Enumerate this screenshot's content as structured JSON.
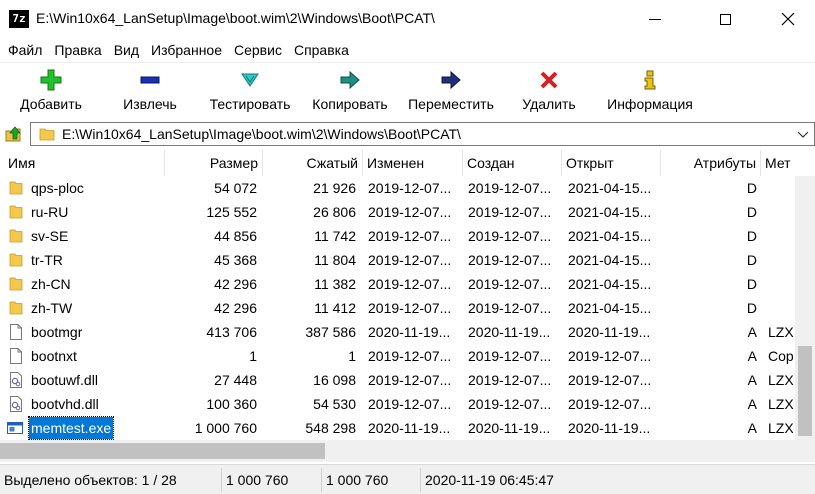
{
  "window": {
    "title": "E:\\Win10x64_LanSetup\\Image\\boot.wim\\2\\Windows\\Boot\\PCAT\\",
    "app_icon_text": "7z"
  },
  "menu": [
    "Файл",
    "Правка",
    "Вид",
    "Избранное",
    "Сервис",
    "Справка"
  ],
  "toolbar": [
    {
      "label": "Добавить",
      "icon": "add-icon",
      "color": "#22c02a"
    },
    {
      "label": "Извлечь",
      "icon": "extract-icon",
      "color": "#1a2fb8"
    },
    {
      "label": "Тестировать",
      "icon": "test-icon",
      "color": "#2fc9c9"
    },
    {
      "label": "Копировать",
      "icon": "copy-icon",
      "color": "#1f8f84"
    },
    {
      "label": "Переместить",
      "icon": "move-icon",
      "color": "#1f2f7a"
    },
    {
      "label": "Удалить",
      "icon": "delete-icon",
      "color": "#d42020"
    },
    {
      "label": "Информация",
      "icon": "info-icon",
      "color": "#e8c31a"
    }
  ],
  "address": {
    "path": "E:\\Win10x64_LanSetup\\Image\\boot.wim\\2\\Windows\\Boot\\PCAT\\"
  },
  "columns": [
    "Имя",
    "Размер",
    "Сжатый",
    "Изменен",
    "Создан",
    "Открыт",
    "Атрибуты",
    "Мет"
  ],
  "files": [
    {
      "name": "qps-ploc",
      "type": "folder",
      "size": "54 072",
      "packed": "21 926",
      "modified": "2019-12-07...",
      "created": "2019-12-07...",
      "accessed": "2021-04-15...",
      "attr": "D",
      "method": ""
    },
    {
      "name": "ru-RU",
      "type": "folder",
      "size": "125 552",
      "packed": "26 806",
      "modified": "2019-12-07...",
      "created": "2019-12-07...",
      "accessed": "2021-04-15...",
      "attr": "D",
      "method": ""
    },
    {
      "name": "sv-SE",
      "type": "folder",
      "size": "44 856",
      "packed": "11 742",
      "modified": "2019-12-07...",
      "created": "2019-12-07...",
      "accessed": "2021-04-15...",
      "attr": "D",
      "method": ""
    },
    {
      "name": "tr-TR",
      "type": "folder",
      "size": "45 368",
      "packed": "11 804",
      "modified": "2019-12-07...",
      "created": "2019-12-07...",
      "accessed": "2021-04-15...",
      "attr": "D",
      "method": ""
    },
    {
      "name": "zh-CN",
      "type": "folder",
      "size": "42 296",
      "packed": "11 382",
      "modified": "2019-12-07...",
      "created": "2019-12-07...",
      "accessed": "2021-04-15...",
      "attr": "D",
      "method": ""
    },
    {
      "name": "zh-TW",
      "type": "folder",
      "size": "42 296",
      "packed": "11 412",
      "modified": "2019-12-07...",
      "created": "2019-12-07...",
      "accessed": "2021-04-15...",
      "attr": "D",
      "method": ""
    },
    {
      "name": "bootmgr",
      "type": "file",
      "size": "413 706",
      "packed": "387 586",
      "modified": "2020-11-19...",
      "created": "2020-11-19...",
      "accessed": "2020-11-19...",
      "attr": "A",
      "method": "LZX"
    },
    {
      "name": "bootnxt",
      "type": "file",
      "size": "1",
      "packed": "1",
      "modified": "2019-12-07...",
      "created": "2019-12-07...",
      "accessed": "2019-12-07...",
      "attr": "A",
      "method": "Cop"
    },
    {
      "name": "bootuwf.dll",
      "type": "dll",
      "size": "27 448",
      "packed": "16 098",
      "modified": "2019-12-07...",
      "created": "2019-12-07...",
      "accessed": "2019-12-07...",
      "attr": "A",
      "method": "LZX"
    },
    {
      "name": "bootvhd.dll",
      "type": "dll",
      "size": "100 360",
      "packed": "54 530",
      "modified": "2019-12-07...",
      "created": "2019-12-07...",
      "accessed": "2019-12-07...",
      "attr": "A",
      "method": "LZX"
    },
    {
      "name": "memtest.exe",
      "type": "exe",
      "size": "1 000 760",
      "packed": "548 298",
      "modified": "2020-11-19...",
      "created": "2020-11-19...",
      "accessed": "2020-11-19...",
      "attr": "A",
      "method": "LZX",
      "selected": true
    }
  ],
  "status": {
    "selected": "Выделено объектов: 1 / 28",
    "size": "1 000 760",
    "packed": "1 000 760",
    "date": "2020-11-19 06:45:47"
  }
}
